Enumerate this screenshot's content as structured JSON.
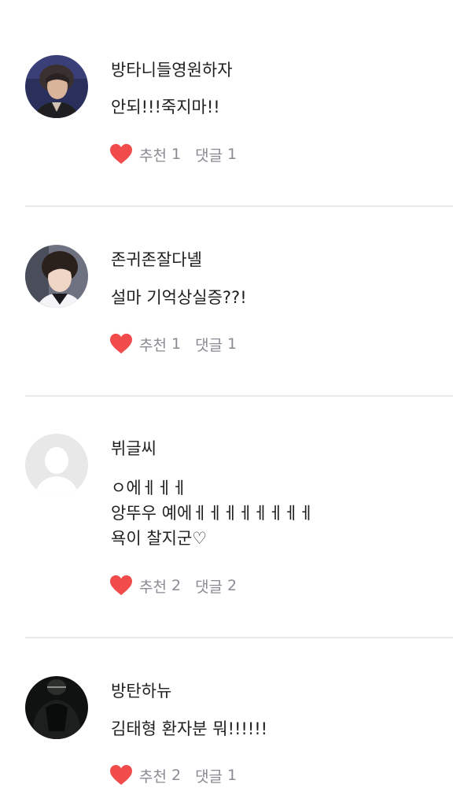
{
  "comments": [
    {
      "author": "방타니들영원하자",
      "text_lines": [
        "안되!!!죽지마!!"
      ],
      "like_label": "추천",
      "like_count": "1",
      "reply_label": "댓글",
      "reply_count": "1"
    },
    {
      "author": "존귀존잘다녤",
      "text_lines": [
        "설마  기억상실증??!"
      ],
      "like_label": "추천",
      "like_count": "1",
      "reply_label": "댓글",
      "reply_count": "1"
    },
    {
      "author": "뷔글씨",
      "text_lines": [
        "ㅇ에ㅔㅔㅔ",
        "앙뚜우 예에ㅔㅔㅔㅔㅔㅔㅔㅔ",
        "욕이 찰지군♡"
      ],
      "like_label": "추천",
      "like_count": "2",
      "reply_label": "댓글",
      "reply_count": "2"
    },
    {
      "author": "방탄하뉴",
      "text_lines": [
        "김태형 환자분 뭐!!!!!!"
      ],
      "like_label": "추천",
      "like_count": "2",
      "reply_label": "댓글",
      "reply_count": "1"
    }
  ],
  "colors": {
    "heart": "#f24b4b",
    "meta_text": "#8b8b93",
    "divider": "#e9e9ec",
    "placeholder_avatar": "#e8e8e8"
  }
}
